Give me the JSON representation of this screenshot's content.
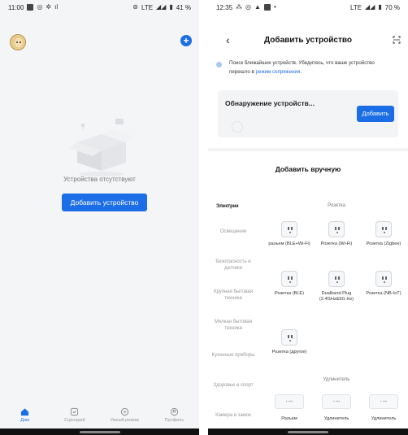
{
  "left_screen": {
    "status": {
      "time": "11:00",
      "right": "LTE",
      "battery": "41 %"
    },
    "empty_text": "Устройства отсутствуют",
    "add_button": "Добавить устройство",
    "nav": [
      {
        "label": "Дом",
        "icon": "home-icon",
        "active": true
      },
      {
        "label": "Сценарий",
        "icon": "scene-icon",
        "active": false
      },
      {
        "label": "Умный режим",
        "icon": "smart-icon",
        "active": false
      },
      {
        "label": "Профиль",
        "icon": "profile-icon",
        "active": false
      }
    ],
    "accent": "#1c6ee6"
  },
  "right_screen": {
    "status": {
      "time": "12:35",
      "right": "LTE",
      "battery": "70 %"
    },
    "title": "Добавить устройство",
    "info_text": "Поиск ближайших устройств. Убедитесь, что ваше устройство перешло в ",
    "info_link": "режим сопряжения",
    "info_end": ".",
    "discover_title": "Обнаружение устройств...",
    "discover_button": "Добавить",
    "manual_title": "Добавить вручную",
    "categories": [
      "Электрик",
      "Освещение",
      "Безопасность и датчики",
      "Крупная бытовая техника",
      "Мелкая бытовая техника",
      "Кухонные приборы",
      "Здоровье и спорт",
      "Камера и замок"
    ],
    "section_socket": "Розетка",
    "devices": [
      {
        "name": "разъем (BLE+Wi-Fi)"
      },
      {
        "name": "Розетка (Wi-Fi)"
      },
      {
        "name": "Розетка (Zigbee)"
      },
      {
        "name": "Розетка (BLE)"
      },
      {
        "name": "Dualband Plug (2.4GHz&5G Hz)"
      },
      {
        "name": "Розетка (NB-IoT)"
      },
      {
        "name": "Розетка (другое)"
      }
    ],
    "section_extender": "Удлинитель",
    "extenders": [
      {
        "name": "Разъем"
      },
      {
        "name": "Удлинитель"
      },
      {
        "name": "Удлинитель"
      }
    ]
  }
}
